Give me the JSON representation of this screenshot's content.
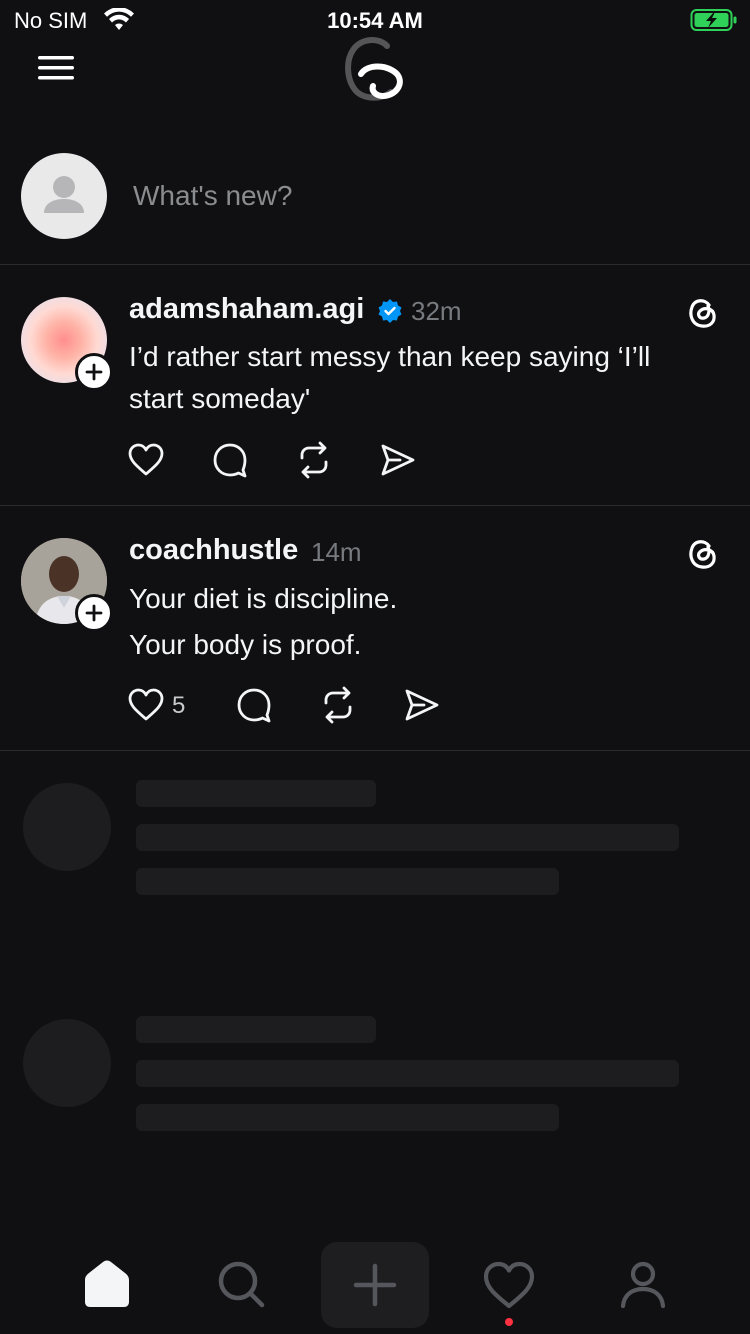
{
  "status_bar": {
    "carrier": "No SIM",
    "time": "10:54 AM",
    "wifi_icon": "wifi-icon",
    "battery_icon": "battery-charging-icon",
    "battery_color": "#30d158"
  },
  "header": {
    "menu_icon": "menu-icon",
    "logo": "threads-logo-icon"
  },
  "composer": {
    "placeholder": "What's new?"
  },
  "posts": [
    {
      "username": "adamshaham.agi",
      "verified": true,
      "time": "32m",
      "text_lines": [
        "I’d rather start messy than keep saying ‘I’ll",
        "start someday'"
      ],
      "like_count": ""
    },
    {
      "username": "coachhustle",
      "verified": false,
      "time": "14m",
      "text_lines": [
        "Your diet is discipline.",
        "Your body is proof."
      ],
      "like_count": "5"
    }
  ],
  "tab_bar": {
    "items": [
      "home-icon",
      "search-icon",
      "compose-plus-icon",
      "activity-heart-icon",
      "profile-icon"
    ],
    "active": "home-icon",
    "notification_dot_color": "#ff3040"
  },
  "colors": {
    "background": "#101012",
    "verified_blue": "#0095f6"
  }
}
